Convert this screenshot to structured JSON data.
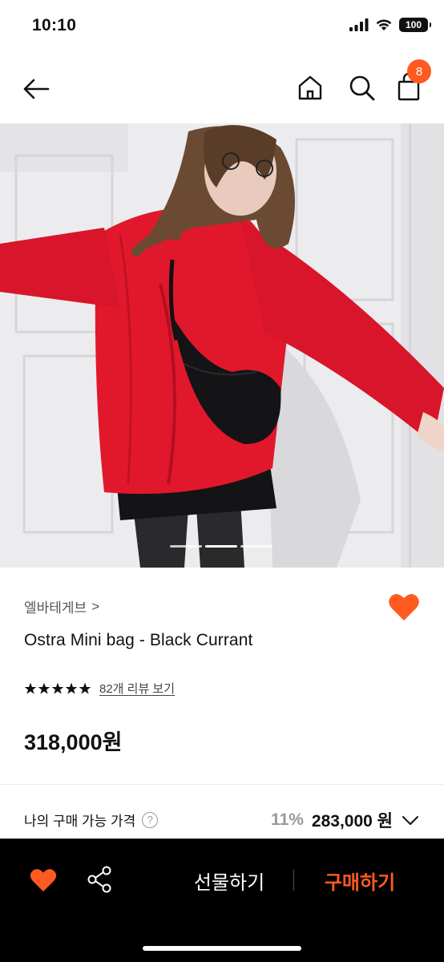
{
  "status_bar": {
    "time": "10:10",
    "battery": "100"
  },
  "nav": {
    "cart_count": "8"
  },
  "hero": {
    "image_description_icon": "product-photo"
  },
  "product": {
    "brand": "엘바테게브",
    "brand_chevron": ">",
    "title": "Ostra Mini bag - Black Currant",
    "rating_stars": 5,
    "review_link": "82개 리뷰 보기",
    "price": "318,000원"
  },
  "my_price": {
    "label": "나의 구매 가능 가격",
    "help": "?",
    "discount": "11%",
    "price": "283,000 원"
  },
  "bottom": {
    "gift_label": "선물하기",
    "buy_label": "구매하기"
  },
  "colors": {
    "accent": "#ff5a1f",
    "bottom_bar": "#000000"
  }
}
